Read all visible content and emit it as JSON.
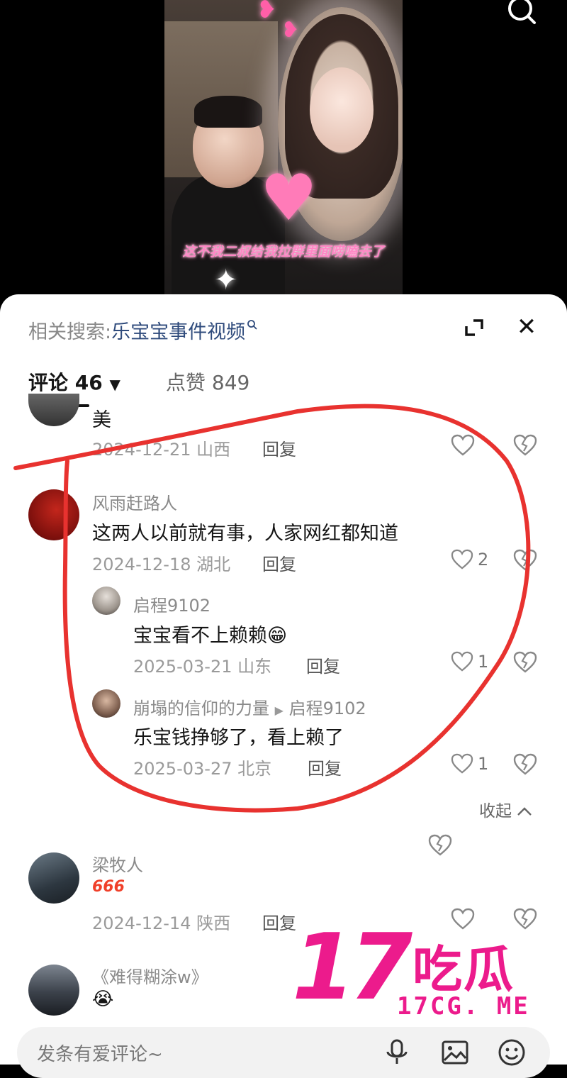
{
  "video": {
    "caption": "这不我二叔给我拉群里面唠嗑去了"
  },
  "related": {
    "label": "相关搜索:",
    "keyword": "乐宝宝事件视频"
  },
  "tabs": {
    "comments": "评论 46",
    "likes": "点赞 849"
  },
  "comments": [
    {
      "text": "美",
      "date": "2024-12-21 山西",
      "reply": "回复"
    },
    {
      "user": "风雨赶路人",
      "text": "这两人以前就有事，人家网红都知道",
      "date": "2024-12-18 湖北",
      "reply": "回复",
      "likes": "2"
    },
    {
      "user": "启程9102",
      "text": "宝宝看不上赖赖😁",
      "date": "2025-03-21 山东",
      "reply": "回复",
      "likes": "1"
    },
    {
      "user": "崩塌的信仰的力量",
      "reply_to": "启程9102",
      "text": "乐宝钱挣够了，看上赖了",
      "date": "2025-03-27 北京",
      "reply": "回复",
      "likes": "1"
    },
    {
      "user": "梁牧人",
      "text": "666",
      "date": "2024-12-14 陕西",
      "reply": "回复"
    },
    {
      "user": "《难得糊涂w》",
      "text": "😭"
    }
  ],
  "collapse_label": "收起",
  "input": {
    "placeholder": "发条有爱评论~"
  },
  "watermark": {
    "number": "17",
    "name": "吃瓜",
    "site": "17CG. ME"
  },
  "colors": {
    "annotation_red": "#e8322f",
    "watermark_pink": "#ec1b8c",
    "keyword_blue": "#2f4b7c"
  }
}
